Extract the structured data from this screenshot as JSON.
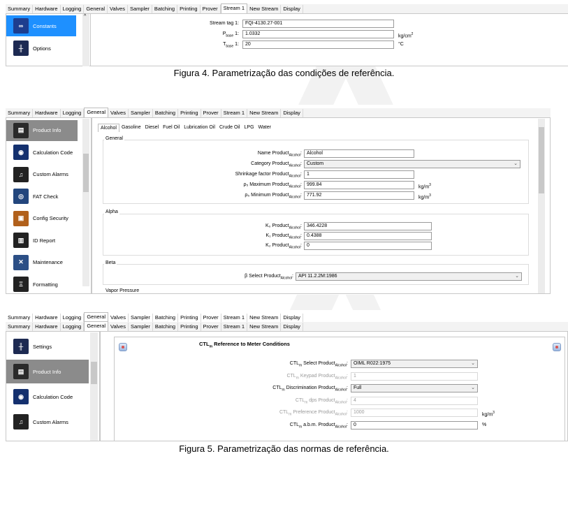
{
  "tabs_all": [
    "Summary",
    "Hardware",
    "Logging",
    "General",
    "Valves",
    "Sampler",
    "Batching",
    "Printing",
    "Prover",
    "Stream 1",
    "New Stream",
    "Display"
  ],
  "fig1": {
    "active_tab": "Stream 1",
    "sidebar": [
      {
        "label": "Constants",
        "icon": "infinity-icon",
        "selected": true
      },
      {
        "label": "Options",
        "icon": "sliders-icon",
        "selected": false
      }
    ],
    "rows": [
      {
        "label_main": "Stream tag 1:",
        "label_sub": "",
        "value": "FQI-4130.27-001",
        "unit": ""
      },
      {
        "label_main": "P",
        "label_sub": "base",
        "label_tail": " 1:",
        "value": "1.0332",
        "unit": "kg/cm",
        "unit_sup": "2"
      },
      {
        "label_main": "T",
        "label_sub": "base",
        "label_tail": " 1:",
        "value": "20",
        "unit": "°C"
      }
    ]
  },
  "caption1": "Figura 4. Parametrização das condições de referência.",
  "fig2": {
    "active_tab": "General",
    "sidebar": [
      {
        "label": "Product Info",
        "icon": "product-info-icon",
        "selected": true
      },
      {
        "label": "Calculation Code",
        "icon": "calc-code-icon"
      },
      {
        "label": "Custom Alarms",
        "icon": "bell-icon"
      },
      {
        "label": "FAT Check",
        "icon": "fat-check-icon"
      },
      {
        "label": "Config Security",
        "icon": "security-icon"
      },
      {
        "label": "ID Report",
        "icon": "report-icon"
      },
      {
        "label": "Maintenance",
        "icon": "wrench-icon"
      },
      {
        "label": "Formatting",
        "icon": "formatting-icon"
      }
    ],
    "subtabs": [
      "Alcohol",
      "Gasoline",
      "Diesel",
      "Fuel Oil",
      "Lubrication Oil",
      "Crude Oil",
      "LPG",
      "Water"
    ],
    "groups": {
      "general": "General",
      "alpha": "Alpha",
      "beta": "Beta",
      "vapor": "Vapor Pressure"
    },
    "general_rows": [
      {
        "label": "Name Product",
        "sub": "Alcohol",
        "value": "Alcohol",
        "unit": "",
        "combo": false
      },
      {
        "label": "Category Product",
        "sub": "Alcohol",
        "value": "Custom",
        "unit": "",
        "combo": true
      },
      {
        "label": "Shrinkage factor Product",
        "sub": "Alcohol",
        "value": "1",
        "unit": "",
        "combo": false
      },
      {
        "label": "ρ₅ Maximum Product",
        "sub": "Alcohol",
        "value": "999.84",
        "unit": "kg/m",
        "unit_sup": "3",
        "combo": false
      },
      {
        "label": "ρ₅ Minimum Product",
        "sub": "Alcohol",
        "value": "771.92",
        "unit": "kg/m",
        "unit_sup": "3",
        "combo": false
      }
    ],
    "alpha_rows": [
      {
        "label": "K₀ Product",
        "sub": "Alcohol",
        "value": "346.4228"
      },
      {
        "label": "K₁ Product",
        "sub": "Alcohol",
        "value": "0.4388"
      },
      {
        "label": "K₂ Product",
        "sub": "Alcohol",
        "value": "0"
      }
    ],
    "beta_row": {
      "label": "β Select Product",
      "sub": "Alcohol",
      "value": "API 11.2.2M:1986"
    }
  },
  "fig3": {
    "active_tab": "General",
    "sidebar": [
      {
        "label": "Settings",
        "icon": "sliders-icon"
      },
      {
        "label": "Product Info",
        "icon": "product-info-icon",
        "selected": true
      },
      {
        "label": "Calculation Code",
        "icon": "calc-code-icon"
      },
      {
        "label": "Custom Alarms",
        "icon": "bell-icon"
      }
    ],
    "section_title_main": "CTL",
    "section_title_sub": "m",
    "section_title_tail": " Reference to Meter Conditions",
    "rows": [
      {
        "pre": "CTL",
        "presub": "m",
        "label": " Select Product",
        "sub": "Alcohol",
        "value": "OIML R022:1975",
        "unit": "",
        "combo": true,
        "disabled": false
      },
      {
        "pre": "CTL",
        "presub": "m",
        "label": " Keypad Product",
        "sub": "Alcohol",
        "value": "1",
        "unit": "",
        "combo": false,
        "disabled": true
      },
      {
        "pre": "CTL",
        "presub": "m",
        "label": " Discrimination Product",
        "sub": "Alcohol",
        "value": "Full",
        "unit": "",
        "combo": true,
        "disabled": false
      },
      {
        "pre": "CTL",
        "presub": "m",
        "label": " dps Product",
        "sub": "Alcohol",
        "value": "4",
        "unit": "",
        "combo": false,
        "disabled": true
      },
      {
        "pre": "CTL",
        "presub": "m",
        "label": " Preference Product",
        "sub": "Alcohol",
        "value": "1000",
        "unit": "kg/m",
        "unit_sup": "3",
        "combo": false,
        "disabled": true
      },
      {
        "pre": "CTL",
        "presub": "m",
        "label": " a.b.m. Product",
        "sub": "Alcohol",
        "value": "0",
        "unit": "%",
        "combo": false,
        "disabled": false
      }
    ]
  },
  "caption2": "Figura 5. Parametrização das normas de referência."
}
